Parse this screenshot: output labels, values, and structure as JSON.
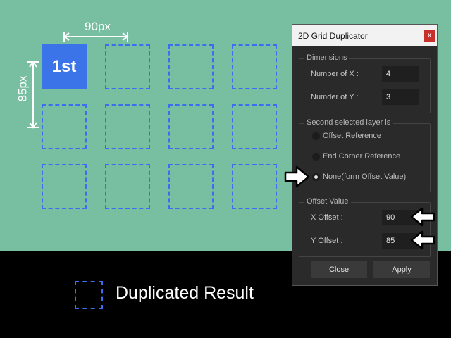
{
  "canvas": {
    "first_cell_label": "1st",
    "dimension_x_label": "90px",
    "dimension_y_label": "85px",
    "background": "#78bfa2",
    "accent": "#3b73e8"
  },
  "legend": {
    "text": "Duplicated Result"
  },
  "dialog": {
    "title": "2D Grid Duplicator",
    "close_label": "x",
    "dimensions": {
      "title": "Dimensions",
      "x_label": "Number of X :",
      "x_value": "4",
      "y_label": "Numder of Y :",
      "y_value": "3"
    },
    "second_layer": {
      "title": "Second selected layer is",
      "options": [
        "Offset Reference",
        "End Corner Reference",
        "None(form Offset Value)"
      ],
      "selected": "None(form Offset Value)"
    },
    "offset": {
      "title": "Offset Value",
      "x_label": "X Offset :",
      "x_value": "90",
      "y_label": "Y Offset :",
      "y_value": "85"
    },
    "buttons": {
      "close": "Close",
      "apply": "Apply"
    }
  }
}
